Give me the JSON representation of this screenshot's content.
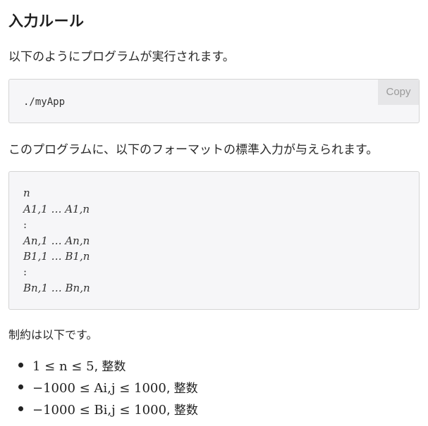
{
  "section": {
    "heading": "入力ルール",
    "intro": "以下のようにプログラムが実行されます。",
    "command": "./myApp",
    "copy_label": "Copy",
    "format_intro": "このプログラムに、以下のフォーマットの標準入力が与えられます。",
    "format_lines": [
      "n",
      "A1,1 … A1,n",
      ":",
      "An,1 … An,n",
      "B1,1 … B1,n",
      ":",
      "Bn,1 … Bn,n"
    ],
    "constraints_intro": "制約は以下です。",
    "constraints": [
      {
        "math": "1 ≤ n ≤ 5",
        "suffix": ", 整数"
      },
      {
        "math": "−1000 ≤ Ai,j ≤ 1000",
        "suffix": ", 整数"
      },
      {
        "math": "−1000 ≤ Bi,j ≤ 1000",
        "suffix": ", 整数"
      }
    ]
  }
}
